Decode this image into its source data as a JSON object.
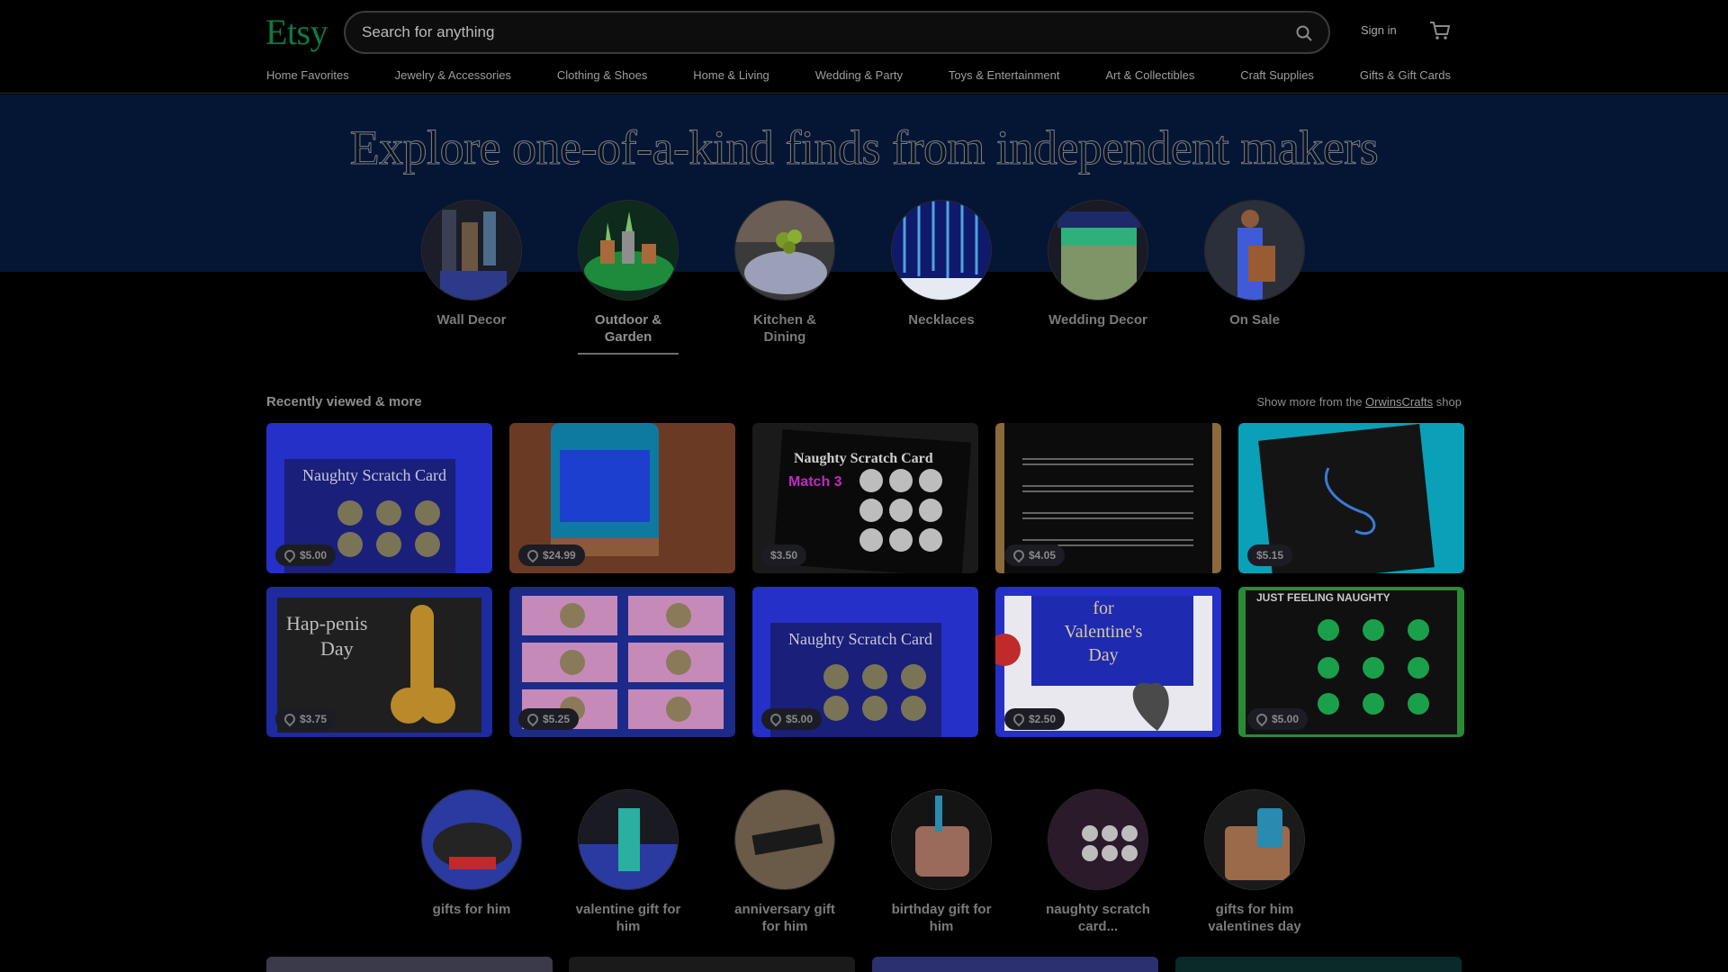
{
  "header": {
    "logo": "Etsy",
    "search_placeholder": "Search for anything",
    "sign_in": "Sign in"
  },
  "nav": [
    "Home Favorites",
    "Jewelry & Accessories",
    "Clothing & Shoes",
    "Home & Living",
    "Wedding & Party",
    "Toys & Entertainment",
    "Art & Collectibles",
    "Craft Supplies",
    "Gifts & Gift Cards"
  ],
  "hero": {
    "title": "Explore one-of-a-kind finds from independent makers",
    "categories": [
      {
        "label": "Wall Decor",
        "active": false
      },
      {
        "label": "Outdoor & Garden",
        "active": true
      },
      {
        "label": "Kitchen & Dining",
        "active": false
      },
      {
        "label": "Necklaces",
        "active": false
      },
      {
        "label": "Wedding Decor",
        "active": false
      },
      {
        "label": "On Sale",
        "active": false
      }
    ]
  },
  "recent": {
    "title": "Recently viewed & more",
    "more_prefix": "Show more from the",
    "shop_name": "OrwinsCrafts",
    "more_suffix": "shop",
    "items": [
      {
        "price": "$5.00",
        "has_tag": true
      },
      {
        "price": "$24.99",
        "has_tag": true
      },
      {
        "price": "$3.50",
        "has_tag": false
      },
      {
        "price": "$4.05",
        "has_tag": true
      },
      {
        "price": "$5.15",
        "has_tag": false
      },
      {
        "price": "$3.75",
        "has_tag": true
      },
      {
        "price": "$5.25",
        "has_tag": true
      },
      {
        "price": "$5.00",
        "has_tag": true
      },
      {
        "price": "$2.50",
        "has_tag": true
      },
      {
        "price": "$5.00",
        "has_tag": true
      }
    ]
  },
  "gifts": [
    {
      "label": "gifts for him"
    },
    {
      "label": "valentine gift for him"
    },
    {
      "label": "anniversary gift for him"
    },
    {
      "label": "birthday gift for him"
    },
    {
      "label": "naughty scratch card..."
    },
    {
      "label": "gifts for him valentines day"
    }
  ],
  "colors": {
    "brand": "#0f7a3f",
    "hero_band": "#051635",
    "background": "#000000"
  }
}
